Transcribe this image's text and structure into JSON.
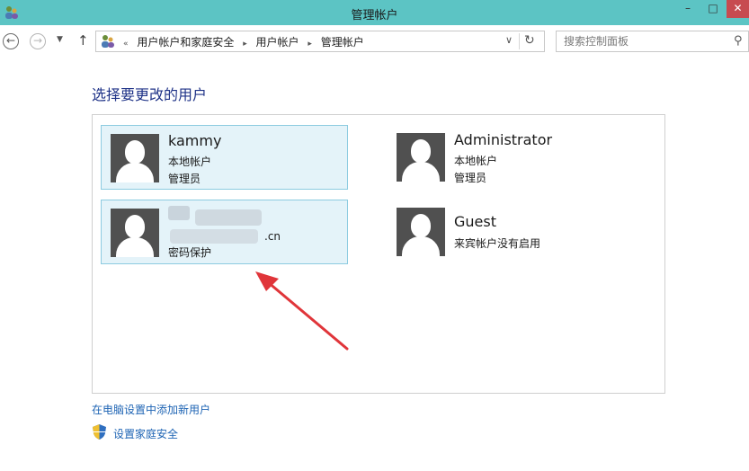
{
  "window": {
    "title": "管理帐户",
    "minimize_glyph": "–",
    "maximize_glyph": "□",
    "close_glyph": "✕"
  },
  "address_bar": {
    "overflow": "«",
    "crumbs": [
      "用户帐户和家庭安全",
      "用户帐户",
      "管理帐户"
    ],
    "separator": "▸"
  },
  "search": {
    "placeholder": "搜索控制面板"
  },
  "content": {
    "heading": "选择要更改的用户",
    "users": [
      {
        "name": "kammy",
        "lines": [
          "本地帐户",
          "管理员"
        ],
        "selected": true
      },
      {
        "name": "",
        "email_suffix": ".cn",
        "lines": [
          "密码保护"
        ],
        "selected": true,
        "obscured": true
      },
      {
        "name": "Administrator",
        "lines": [
          "本地帐户",
          "管理员"
        ],
        "selected": false
      },
      {
        "name": "Guest",
        "lines": [
          "来宾帐户没有启用"
        ],
        "selected": false
      }
    ]
  },
  "links": {
    "add_user": "在电脑设置中添加新用户",
    "family_safety": "设置家庭安全"
  },
  "colors": {
    "title_bar": "#5cc4c4",
    "close_button": "#c74b50",
    "heading": "#1e3287",
    "link": "#1e64b4",
    "tile_selected_bg": "#e4f3f9",
    "tile_selected_border": "#8ccbe0",
    "arrow": "#e0353a"
  }
}
